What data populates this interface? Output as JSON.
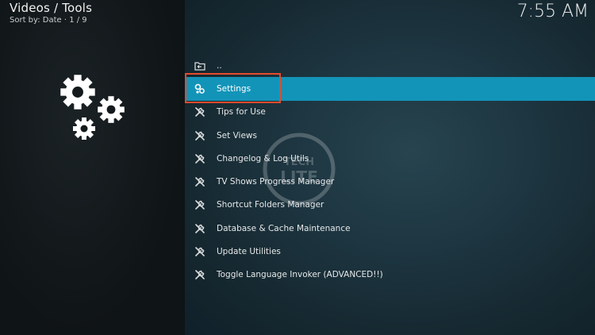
{
  "header": {
    "title": "Videos / Tools",
    "sort_info": "Sort by: Date · 1 / 9",
    "clock": "7:55 AM"
  },
  "sidebar": {
    "hero_icon": "gears-icon"
  },
  "list": {
    "items": [
      {
        "label": "..",
        "icon": "folder-back-icon",
        "selected": false
      },
      {
        "label": "Settings",
        "icon": "settings-icon",
        "selected": true
      },
      {
        "label": "Tips for Use",
        "icon": "tools-icon",
        "selected": false
      },
      {
        "label": "Set Views",
        "icon": "tools-icon",
        "selected": false
      },
      {
        "label": "Changelog & Log Utils",
        "icon": "tools-icon",
        "selected": false
      },
      {
        "label": "TV Shows Progress Manager",
        "icon": "tools-icon",
        "selected": false
      },
      {
        "label": "Shortcut Folders Manager",
        "icon": "tools-icon",
        "selected": false
      },
      {
        "label": "Database & Cache Maintenance",
        "icon": "tools-icon",
        "selected": false
      },
      {
        "label": "Update Utilities",
        "icon": "tools-icon",
        "selected": false
      },
      {
        "label": "Toggle Language Invoker (ADVANCED!!)",
        "icon": "tools-icon",
        "selected": false
      }
    ]
  },
  "watermark": {
    "line1": "TECH",
    "line2": "LITE"
  },
  "colors": {
    "selection": "#1294b8",
    "focus_outline": "#e44b2c"
  }
}
